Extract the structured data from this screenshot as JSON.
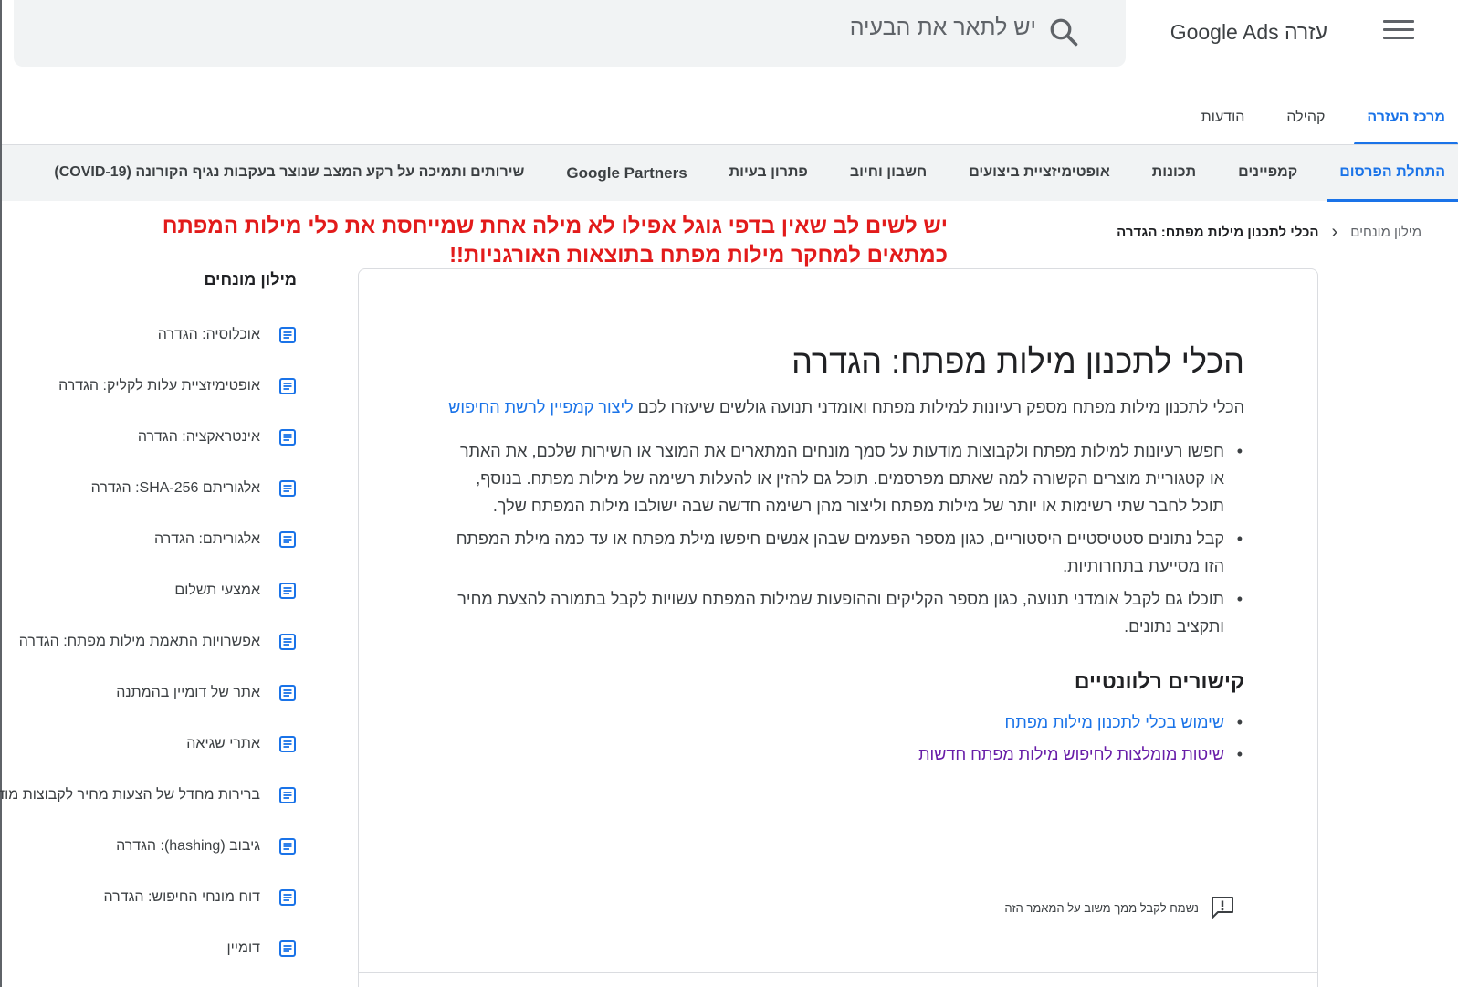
{
  "header": {
    "app_title": "עזרה Google Ads",
    "search_placeholder": "יש לתאר את הבעיה"
  },
  "top_tabs": [
    {
      "label": "מרכז העזרה",
      "active": true
    },
    {
      "label": "קהילה",
      "active": false
    },
    {
      "label": "הודעות",
      "active": false
    }
  ],
  "subnav": [
    {
      "label": "התחלת הפרסום",
      "active": true
    },
    {
      "label": "קמפיינים"
    },
    {
      "label": "תכונות"
    },
    {
      "label": "אופטימיזציית ביצועים"
    },
    {
      "label": "חשבון וחיוב"
    },
    {
      "label": "פתרון בעיות"
    },
    {
      "label": "Google Partners"
    },
    {
      "label": "שירותים ותמיכה על רקע המצב שנוצר בעקבות נגיף הקורונה (COVID-19)"
    }
  ],
  "breadcrumb": {
    "root": "מילון מונחים",
    "current": "הכלי לתכנון מילות מפתח: הגדרה"
  },
  "annotation": "יש לשים לב שאין בדפי גוגל אפילו לא מילה אחת שמייחסת את כלי מילות המפתח כמתאים למחקר מילות מפתח בתוצאות האורגניות!!",
  "article": {
    "title": "הכלי לתכנון מילות מפתח: הגדרה",
    "intro_text": "הכלי לתכנון מילות מפתח מספק רעיונות למילות מפתח ואומדני תנועה גולשים שיעזרו לכם ",
    "intro_link": "ליצור קמפיין לרשת החיפוש",
    "bullets": [
      "חפשו רעיונות למילות מפתח ולקבוצות מודעות על סמך מונחים המתארים את המוצר או השירות שלכם, את האתר או קטגוריית מוצרים הקשורה למה שאתם מפרסמים. תוכל גם להזין או להעלות רשימה של מילות מפתח. בנוסף, תוכל לחבר שתי רשימות או יותר של מילות מפתח וליצור מהן רשימה חדשה שבה ישולבו מילות המפתח שלך.",
      "קבל נתונים סטטיסטיים היסטוריים, כגון מספר הפעמים שבהן אנשים חיפשו מילת מפתח או עד כמה מילת המפתח הזו מסייעת בתחרותיות.",
      "תוכלו גם לקבל אומדני תנועה, כגון מספר הקליקים וההופעות שמילות המפתח עשויות לקבל בתמורה להצעת מחיר ותקציב נתונים."
    ],
    "related_title": "קישורים רלוונטיים",
    "related_links": [
      {
        "label": "שימוש בכלי לתכנון מילות מפתח",
        "visited": false
      },
      {
        "label": "שיטות מומלצות לחיפוש מילות מפתח חדשות",
        "visited": true
      }
    ],
    "feedback": "נשמח לקבל ממך משוב על המאמר הזה"
  },
  "glossary": {
    "title": "מילון מונחים",
    "items": [
      "אוכלוסיה: הגדרה",
      "אופטימיזציית עלות לקליק: הגדרה",
      "אינטראקציה: הגדרה",
      "אלגוריתם SHA-256: הגדרה",
      "אלגוריתם: הגדרה",
      "אמצעי תשלום",
      "אפשרויות התאמת מילות מפתח: הגדרה",
      "אתר של דומיין בהמתנה",
      "אתרי שגיאה",
      "ברירות מחדל של הצעות מחיר לקבוצות מודעות",
      "גיבוב (hashing): הגדרה",
      "דוח מונחי החיפוש: הגדרה",
      "דומיין"
    ]
  },
  "colors": {
    "accent": "#1a73e8",
    "annotation": "#e21b1b",
    "visited_link": "#681da8"
  }
}
